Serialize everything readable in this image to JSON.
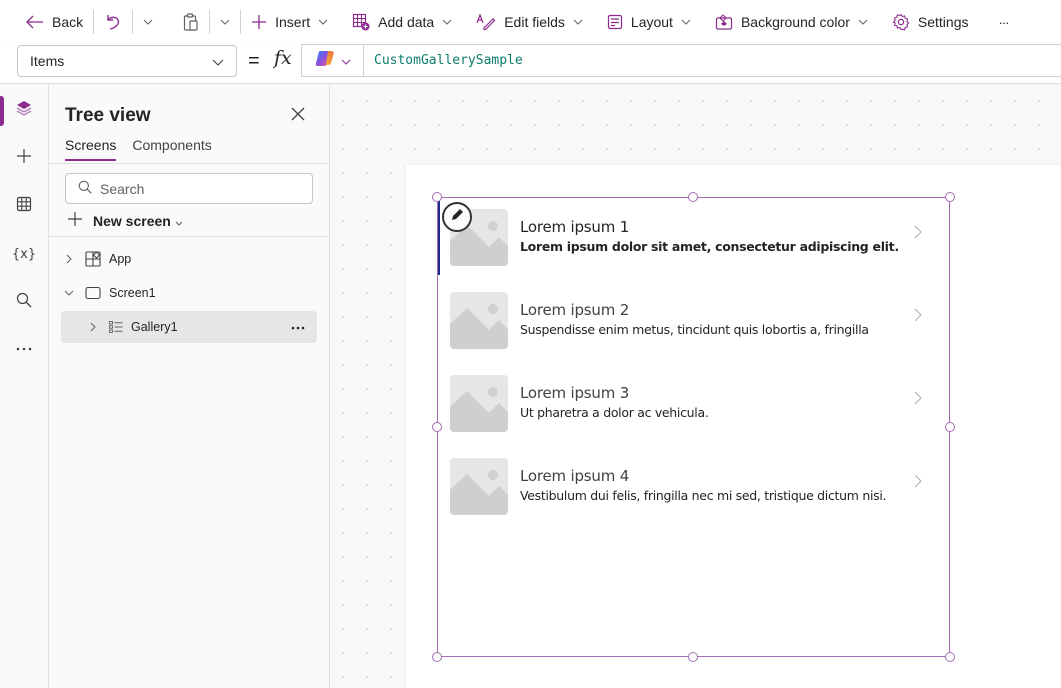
{
  "toolbar": {
    "back": "Back",
    "insert": "Insert",
    "add_data": "Add data",
    "edit_fields": "Edit fields",
    "layout": "Layout",
    "background_color": "Background color",
    "settings": "Settings",
    "more": "···"
  },
  "formula_bar": {
    "property": "Items",
    "equals": "=",
    "fx": "fx",
    "formula": "CustomGallerySample"
  },
  "rail": {
    "items": [
      {
        "name": "tree-view",
        "icon": "layers-icon",
        "active": true
      },
      {
        "name": "insert",
        "icon": "plus-icon"
      },
      {
        "name": "data",
        "icon": "table-icon"
      },
      {
        "name": "variables",
        "icon": "variables-icon",
        "label": "{x}"
      },
      {
        "name": "search",
        "icon": "search-icon"
      },
      {
        "name": "more",
        "icon": "more-icon"
      }
    ]
  },
  "tree_view": {
    "title": "Tree view",
    "tabs": [
      {
        "label": "Screens",
        "active": true
      },
      {
        "label": "Components",
        "active": false
      }
    ],
    "search_placeholder": "Search",
    "new_screen": "New screen",
    "nodes": [
      {
        "label": "App",
        "icon": "app-icon",
        "expanded": false,
        "level": 0
      },
      {
        "label": "Screen1",
        "icon": "screen-icon",
        "expanded": true,
        "level": 0
      },
      {
        "label": "Gallery1",
        "icon": "gallery-icon",
        "expanded": false,
        "level": 1,
        "selected": true
      }
    ]
  },
  "gallery": {
    "items": [
      {
        "title": "Lorem ipsum 1",
        "subtitle": "Lorem ipsum dolor sit amet, consectetur adipiscing elit.",
        "selected": true
      },
      {
        "title": "Lorem ipsum 2",
        "subtitle": "Suspendisse enim metus, tincidunt quis lobortis a, fringilla"
      },
      {
        "title": "Lorem ipsum 3",
        "subtitle": "Ut pharetra a dolor ac vehicula."
      },
      {
        "title": "Lorem ipsum 4",
        "subtitle": "Vestibulum dui felis, fringilla nec mi sed, tristique dictum nisi."
      }
    ]
  },
  "colors": {
    "accent": "#8d2c8f",
    "selection": "#a46fb0",
    "formula_text": "#0c7c6e"
  }
}
